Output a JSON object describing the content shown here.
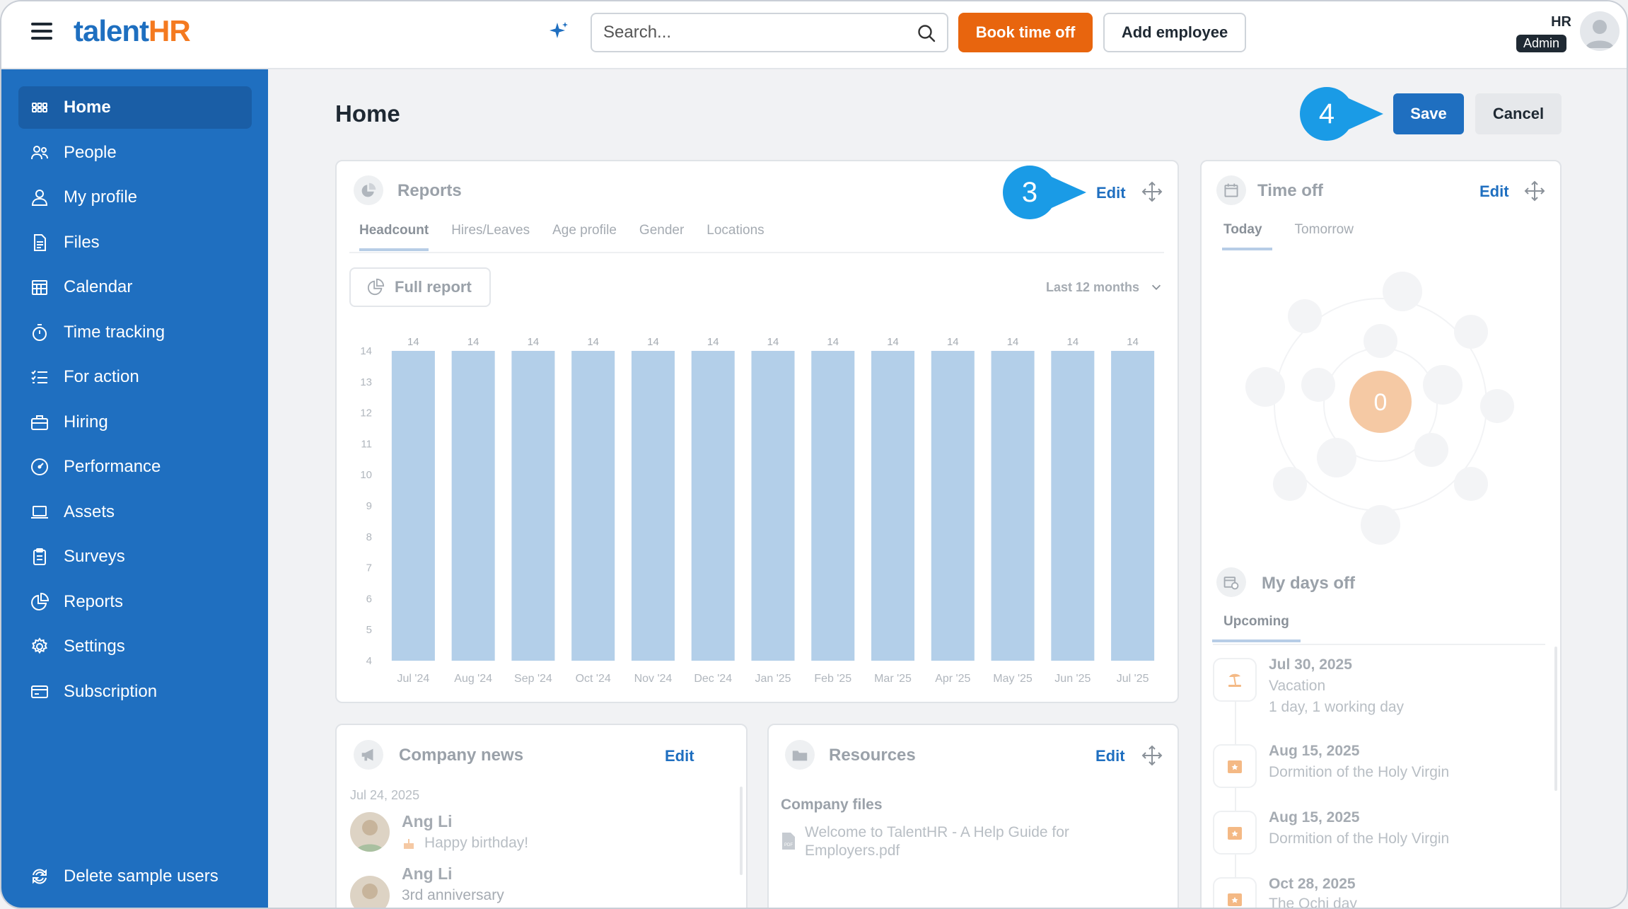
{
  "header": {
    "logo_text_a": "talent",
    "logo_text_b": "HR",
    "search_placeholder": "Search...",
    "book_time_off": "Book time off",
    "add_employee": "Add employee",
    "user_name": "HR",
    "user_role": "Admin"
  },
  "sidebar": {
    "items": [
      {
        "label": "Home",
        "icon": "grid-icon"
      },
      {
        "label": "People",
        "icon": "people-icon"
      },
      {
        "label": "My profile",
        "icon": "user-icon"
      },
      {
        "label": "Files",
        "icon": "file-icon"
      },
      {
        "label": "Calendar",
        "icon": "calendar-icon"
      },
      {
        "label": "Time tracking",
        "icon": "stopwatch-icon"
      },
      {
        "label": "For action",
        "icon": "checklist-icon"
      },
      {
        "label": "Hiring",
        "icon": "briefcase-icon"
      },
      {
        "label": "Performance",
        "icon": "gauge-icon"
      },
      {
        "label": "Assets",
        "icon": "laptop-icon"
      },
      {
        "label": "Surveys",
        "icon": "clipboard-icon"
      },
      {
        "label": "Reports",
        "icon": "pie-chart-icon"
      },
      {
        "label": "Settings",
        "icon": "gear-icon"
      },
      {
        "label": "Subscription",
        "icon": "card-icon"
      }
    ],
    "footer": "Delete sample users"
  },
  "main": {
    "title": "Home",
    "save": "Save",
    "cancel": "Cancel",
    "step_3": "3",
    "step_4": "4"
  },
  "reports": {
    "title": "Reports",
    "edit": "Edit",
    "tabs": [
      "Headcount",
      "Hires/Leaves",
      "Age profile",
      "Gender",
      "Locations"
    ],
    "full_report": "Full report",
    "period": "Last 12 months"
  },
  "chart_data": {
    "type": "bar",
    "categories": [
      "Jul '24",
      "Aug '24",
      "Sep '24",
      "Oct '24",
      "Nov '24",
      "Dec '24",
      "Jan '25",
      "Feb '25",
      "Mar '25",
      "Apr '25",
      "May '25",
      "Jun '25",
      "Jul '25"
    ],
    "values": [
      14,
      14,
      14,
      14,
      14,
      14,
      14,
      14,
      14,
      14,
      14,
      14,
      14
    ],
    "yticks": [
      14,
      13,
      12,
      11,
      10,
      9,
      8,
      7,
      6,
      5,
      4
    ],
    "ylim": [
      4,
      14
    ],
    "bar_color": "#b3cfe9",
    "grid": false,
    "legend": "none"
  },
  "time_off": {
    "title": "Time off",
    "edit": "Edit",
    "tabs": [
      "Today",
      "Tomorrow"
    ],
    "count": "0",
    "my_days_off": "My days off",
    "upcoming": "Upcoming",
    "entries": [
      {
        "date": "Jul 30, 2025",
        "type": "Vacation",
        "detail": "1 day, 1 working day",
        "icon": "beach-icon"
      },
      {
        "date": "Aug 15, 2025",
        "type": "Dormition of the Holy Virgin",
        "icon": "holiday-icon"
      },
      {
        "date": "Aug 15, 2025",
        "type": "Dormition of the Holy Virgin",
        "icon": "holiday-icon"
      },
      {
        "date": "Oct 28, 2025",
        "type": "The Ochi day",
        "icon": "holiday-icon"
      }
    ]
  },
  "company_news": {
    "title": "Company news",
    "edit": "Edit",
    "date": "Jul 24, 2025",
    "items": [
      {
        "name": "Ang Li",
        "text": "Happy birthday!"
      },
      {
        "name": "Ang Li",
        "text": "3rd anniversary"
      }
    ]
  },
  "resources": {
    "title": "Resources",
    "edit": "Edit",
    "section": "Company files",
    "file_line1": "Welcome to TalentHR - A Help Guide for",
    "file_line2": "Employers.pdf"
  },
  "colors": {
    "sidebar": "#1f6fc0",
    "accent_orange": "#e8650e",
    "step_badge": "#1a9be6",
    "bar": "#b3cfe9",
    "count_bubble": "#f5c9a4"
  }
}
